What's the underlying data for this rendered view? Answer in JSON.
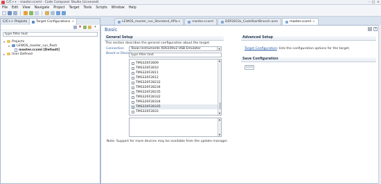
{
  "window": {
    "title": "C/C++ - master.ccxml - Code Composer Studio (Licensed)",
    "controls": [
      "–",
      "□",
      "×"
    ]
  },
  "menu": [
    "File",
    "Edit",
    "View",
    "Navigate",
    "Project",
    "Target",
    "Tools",
    "Scripts",
    "Window",
    "Help"
  ],
  "left": {
    "tabs": [
      "C/C++ Projects",
      "Target Configurations"
    ],
    "filter": "type filter text",
    "tree": [
      "Projects",
      "LEWOS_master_run_flash",
      "master.ccxml [Default]",
      "User Defined"
    ]
  },
  "editor_tabs": [
    {
      "label": "LEWOS_master_run_Standard_APIs.c",
      "active": false
    },
    {
      "label": "master.ccxml",
      "active": false
    },
    {
      "label": "DSP2833x_CodeStartBranch.asm",
      "active": false
    },
    {
      "label": "master.ccxml",
      "active": true
    }
  ],
  "editor": {
    "title": "Basic",
    "general": {
      "heading": "General Setup",
      "description": "This section describes the general configuration about the target.",
      "connection_label": "Connection",
      "connection_value": "Texas Instruments XDS100v2 USB Emulator",
      "board_label": "Board or Device",
      "board_filter": "type filter text",
      "devices": [
        {
          "name": "TMS320F2809",
          "checked": false
        },
        {
          "name": "TMS320F2810",
          "checked": false
        },
        {
          "name": "TMS320F2811",
          "checked": false
        },
        {
          "name": "TMS320F2812",
          "checked": false
        },
        {
          "name": "TMS320F28232",
          "checked": false
        },
        {
          "name": "TMS320F28234",
          "checked": false
        },
        {
          "name": "TMS320F28235",
          "checked": false
        },
        {
          "name": "TMS320F28332",
          "checked": false
        },
        {
          "name": "TMS320F28334",
          "checked": false
        },
        {
          "name": "TMS320F28335",
          "checked": true
        },
        {
          "name": "TMS320F2833",
          "checked": false
        }
      ],
      "note": "Note: Support for more devices may be available from the update manager."
    },
    "advanced": {
      "heading": "Advanced Setup",
      "link_text": "Target Configuration",
      "link_rest": ": lists the configuration options for the target."
    },
    "save": {
      "heading": "Save Configuration",
      "button": "Save"
    }
  }
}
